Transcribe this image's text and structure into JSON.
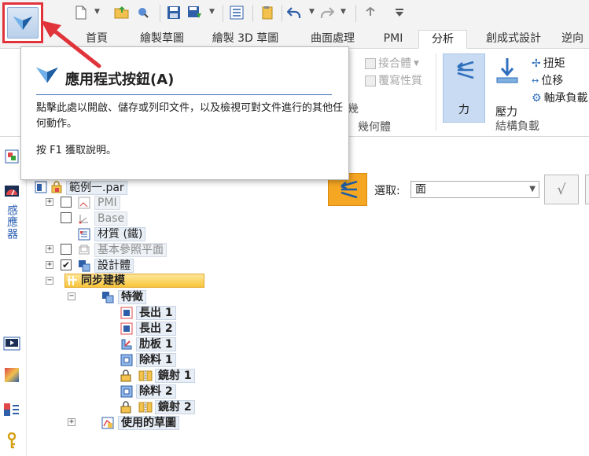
{
  "qat": {
    "app_button_icon": "application-button-icon",
    "icons": [
      "new-document-icon",
      "open-folder-icon",
      "inspect-icon",
      "save-icon",
      "save-as-icon",
      "properties-icon",
      "library-icon",
      "undo-icon",
      "redo-icon",
      "repeat-icon",
      "customize-qat-icon"
    ]
  },
  "tabs": [
    {
      "label": "首頁",
      "active": false
    },
    {
      "label": "繪製草圖",
      "active": false
    },
    {
      "label": "繪製 3D 草圖",
      "active": false
    },
    {
      "label": "曲面處理",
      "active": false
    },
    {
      "label": "PMI",
      "active": false
    },
    {
      "label": "分析",
      "active": true
    },
    {
      "label": "創成式設計",
      "active": false
    },
    {
      "label": "逆向",
      "active": false
    }
  ],
  "ribbon": {
    "joint_body": "接合體",
    "override_properties": "覆寫性質",
    "geometry_group": "幾何體",
    "geometry_partial": "幾",
    "force": "力",
    "pressure": "壓力",
    "torque": "扭矩",
    "displacement": "位移",
    "bearing_load": "軸承負載",
    "structural_loads_group": "結構負載"
  },
  "tooltip": {
    "title": "應用程式按鈕(A)",
    "body": "點擊此處以開啟、儲存或列印文件，以及檢視可對文件進行的其他任何動作。",
    "help": "按 F1 獲取說明。"
  },
  "left_strip": {
    "sensors_label": "感應器"
  },
  "tree": {
    "root": "範例一.par",
    "pmi": "PMI",
    "base": "Base",
    "material": "材質 (鐵)",
    "base_ref_planes": "基本參照平面",
    "design_body": "設計體",
    "sync_modeling": "同步建模",
    "features": "特徵",
    "extrude1": "長出 1",
    "extrude2": "長出 2",
    "rib1": "肋板 1",
    "cut1": "除料 1",
    "mirror1": "鏡射 1",
    "cut2": "除料 2",
    "mirror2": "鏡射 2",
    "used_sketches": "使用的草圖"
  },
  "command_bar": {
    "select_label": "選取:",
    "select_value": "面"
  },
  "colors": {
    "accent_orange": "#f5a623",
    "highlight_red": "#e0333a",
    "link_blue": "#2b5fb3"
  }
}
